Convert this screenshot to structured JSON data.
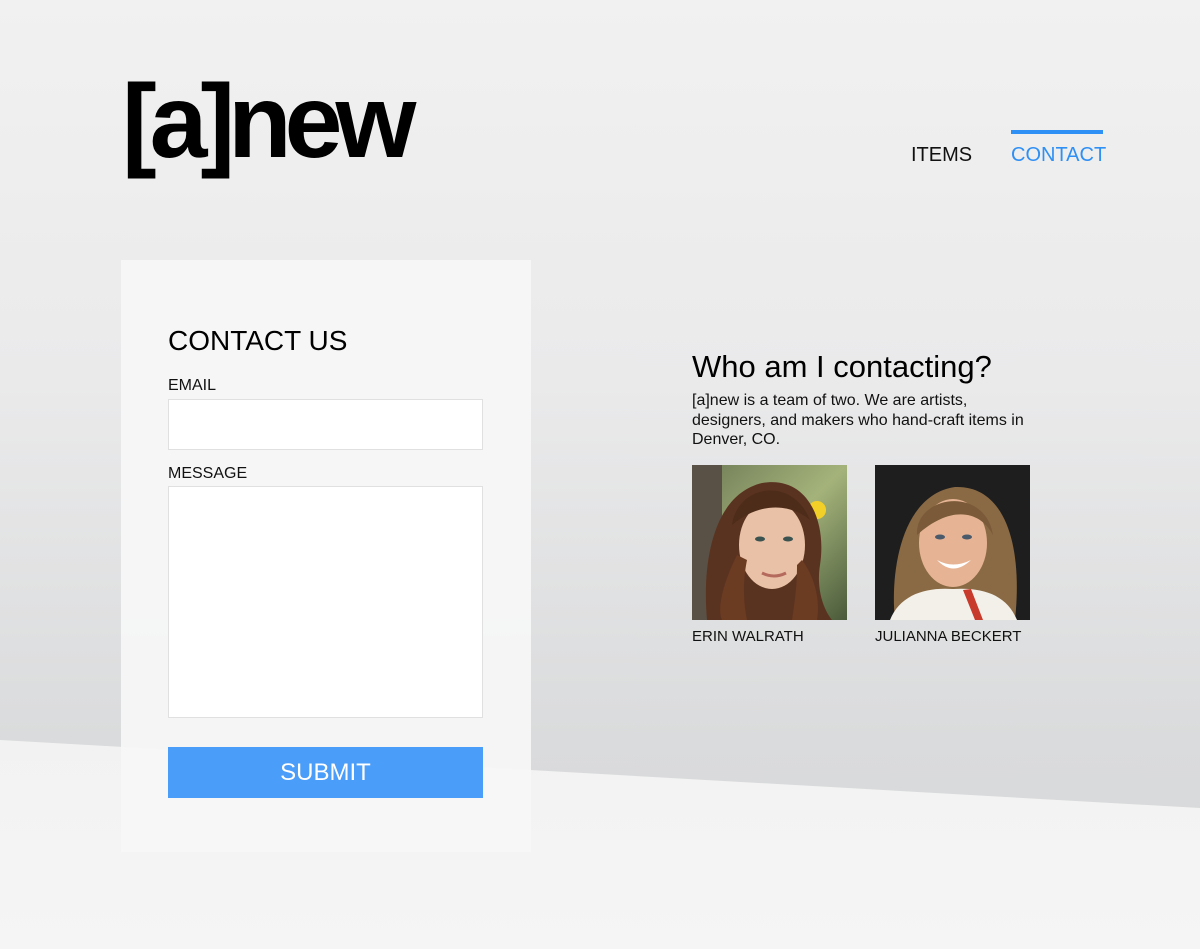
{
  "logo": {
    "text": "[a]new"
  },
  "nav": {
    "items_label": "ITEMS",
    "contact_label": "CONTACT",
    "accent_color": "#2e8ff5"
  },
  "form": {
    "title": "CONTACT US",
    "email_label": "EMAIL",
    "email_value": "",
    "email_placeholder": "",
    "message_label": "MESSAGE",
    "message_value": "",
    "message_placeholder": "",
    "submit_label": "SUBMIT",
    "submit_color": "#4a9df8"
  },
  "about": {
    "title": "Who am I contacting?",
    "text": "[a]new is a team of two. We are artists, designers, and makers who hand-craft items in Denver, CO.",
    "people": [
      {
        "name": "ERIN WALRATH",
        "photo_icon": "portrait-photo"
      },
      {
        "name": "JULIANNA BECKERT",
        "photo_icon": "portrait-photo"
      }
    ]
  }
}
